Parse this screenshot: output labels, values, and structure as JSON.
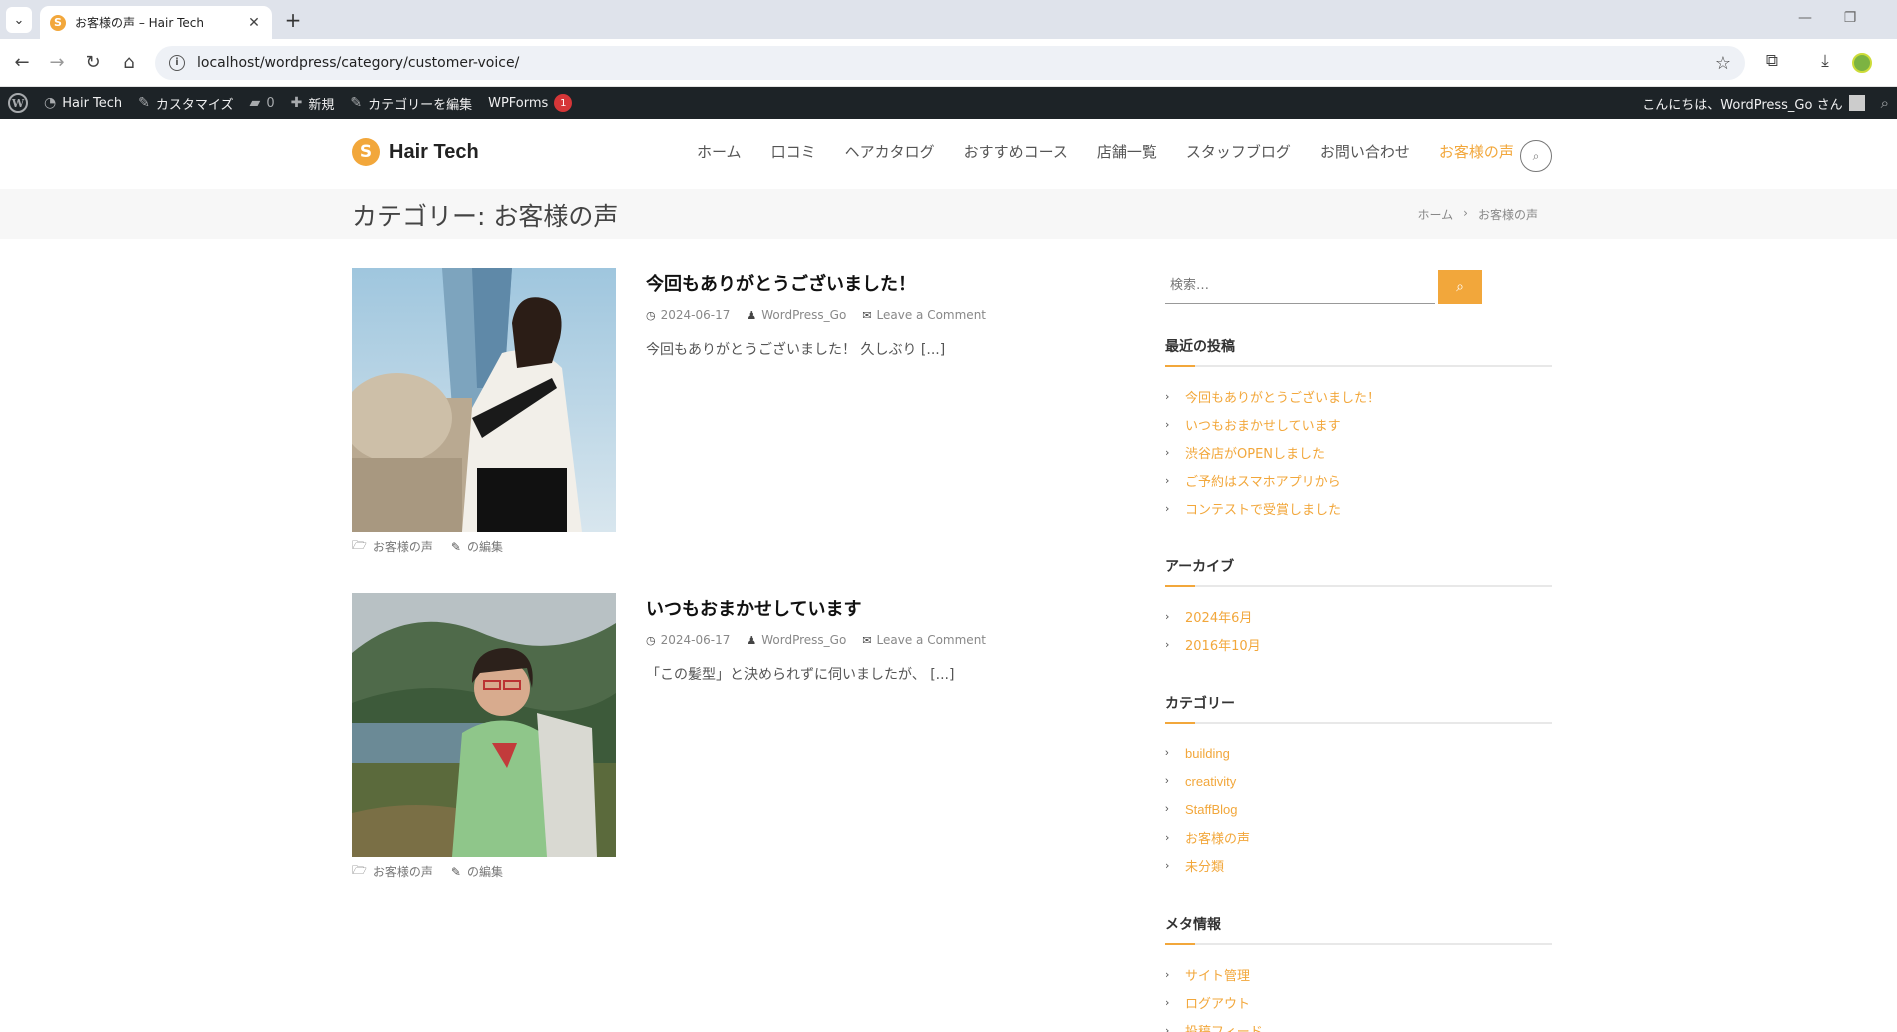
{
  "browser": {
    "tab_title": "お客様の声 – Hair Tech",
    "tab_favicon": "S",
    "tab_close": "✕",
    "new_tab": "+",
    "url": "localhost/wordpress/category/customer-voice/"
  },
  "adminbar": {
    "wp_logo": "W",
    "site_name": "Hair Tech",
    "customize": "カスタマイズ",
    "comments_count": "0",
    "new": "新規",
    "edit_category": "カテゴリーを編集",
    "wpforms": "WPForms",
    "wpforms_badge": "1",
    "greeting": "こんにちは、WordPress_Go さん"
  },
  "header": {
    "logo_mark": "S",
    "logo_text": "Hair Tech",
    "nav": [
      "ホーム",
      "口コミ",
      "ヘアカタログ",
      "おすすめコース",
      "店舗一覧",
      "スタッフブログ",
      "お問い合わせ",
      "お客様の声"
    ],
    "nav_current_index": 7
  },
  "page_header": {
    "title": "カテゴリー: お客様の声",
    "breadcrumb": [
      "ホーム",
      "お客様の声"
    ],
    "breadcrumb_sep": "›"
  },
  "posts": [
    {
      "title": "今回もありがとうございました！",
      "date": "2024-06-17",
      "author": "WordPress_Go",
      "comments": "Leave a Comment",
      "excerpt": "今回もありがとうございました！ 久しぶり",
      "more": "[...]",
      "category": "お客様の声",
      "edit": "の編集"
    },
    {
      "title": "いつもおまかせしています",
      "date": "2024-06-17",
      "author": "WordPress_Go",
      "comments": "Leave a Comment",
      "excerpt": "「この髪型」と決められずに伺いましたが、",
      "more": "[...]",
      "category": "お客様の声",
      "edit": "の編集"
    }
  ],
  "sidebar": {
    "search_placeholder": "検索…",
    "recent_title": "最近の投稿",
    "recent": [
      "今回もありがとうございました！",
      "いつもおまかせしています",
      "渋谷店がOPENしました",
      "ご予約はスマホアプリから",
      "コンテストで受賞しました"
    ],
    "archive_title": "アーカイブ",
    "archives": [
      "2024年6月",
      "2016年10月"
    ],
    "category_title": "カテゴリー",
    "categories": [
      "building",
      "creativity",
      "StaffBlog",
      "お客様の声",
      "未分類"
    ],
    "meta_title": "メタ情報",
    "meta": [
      "サイト管理",
      "ログアウト",
      "投稿フィード"
    ]
  },
  "colors": {
    "accent": "#f2a73b",
    "adminbar": "#1d2327"
  }
}
